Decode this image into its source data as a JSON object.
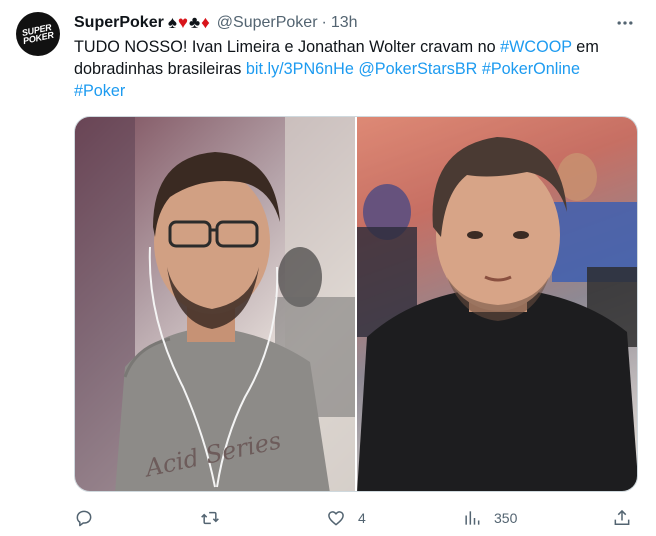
{
  "tweet": {
    "display_name": "SuperPoker",
    "name_suits": [
      "♠",
      "♥",
      "♣",
      "♦"
    ],
    "handle": "@SuperPoker",
    "separator": "·",
    "time": "13h",
    "avatar_text": [
      "SUPER",
      "POKER"
    ],
    "text_part1": "TUDO NOSSO! Ivan Limeira e Jonathan Wolter cravam no ",
    "hashtag_wcoop": "#WCOOP",
    "text_part2": " em dobradinhas brasileiras ",
    "link": "bit.ly/3PN6nHe",
    "mention": "@PokerStarsBR",
    "hashtag_pokeronline": "#PokerOnline",
    "hashtag_poker": "#Poker",
    "shirt_text": "Acid Series"
  },
  "actions": {
    "reply_count": "",
    "retweet_count": "",
    "like_count": "4",
    "view_count": "350"
  },
  "icons": {
    "more": "more-icon",
    "reply": "reply-icon",
    "retweet": "retweet-icon",
    "like": "like-icon",
    "views": "views-icon",
    "share": "share-icon"
  },
  "colors": {
    "link": "#1d9bf0",
    "secondary_text": "#536471",
    "red_suit": "#d8141a"
  }
}
